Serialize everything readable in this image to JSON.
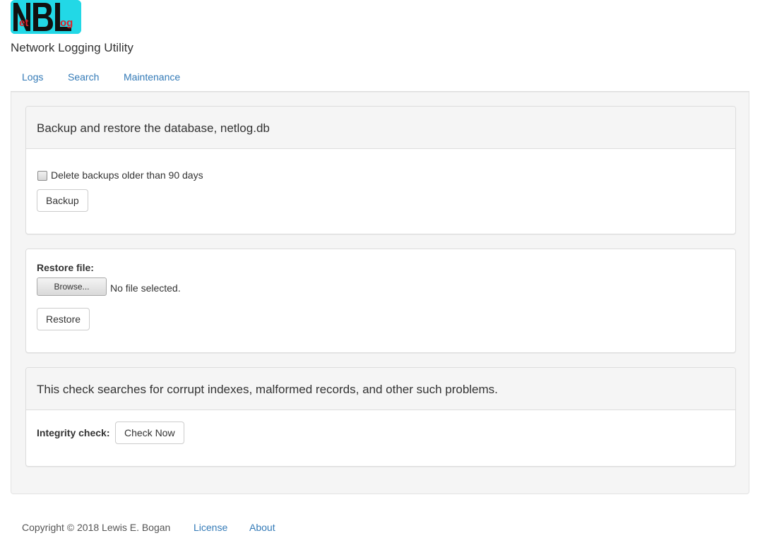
{
  "app": {
    "logo_alt": "NetBLog",
    "title": "Network Logging Utility"
  },
  "nav": {
    "items": [
      {
        "label": "Logs"
      },
      {
        "label": "Search"
      },
      {
        "label": "Maintenance"
      }
    ]
  },
  "backup_panel": {
    "heading": "Backup and restore the database, netlog.db",
    "delete_old_label": "Delete backups older than 90 days",
    "delete_old_checked": false,
    "backup_button": "Backup"
  },
  "restore_panel": {
    "restore_label": "Restore file:",
    "browse_button": "Browse...",
    "file_status": "No file selected.",
    "restore_button": "Restore"
  },
  "integrity_panel": {
    "heading": "This check searches for corrupt indexes, malformed records, and other such problems.",
    "integrity_label": "Integrity check:",
    "check_button": "Check Now"
  },
  "footer": {
    "copyright": "Copyright © 2018 Lewis E. Bogan",
    "license_link": "License",
    "about_link": "About"
  },
  "colors": {
    "link": "#337ab7",
    "logo_bg": "#22d8e6",
    "logo_accent": "#e0202a"
  }
}
